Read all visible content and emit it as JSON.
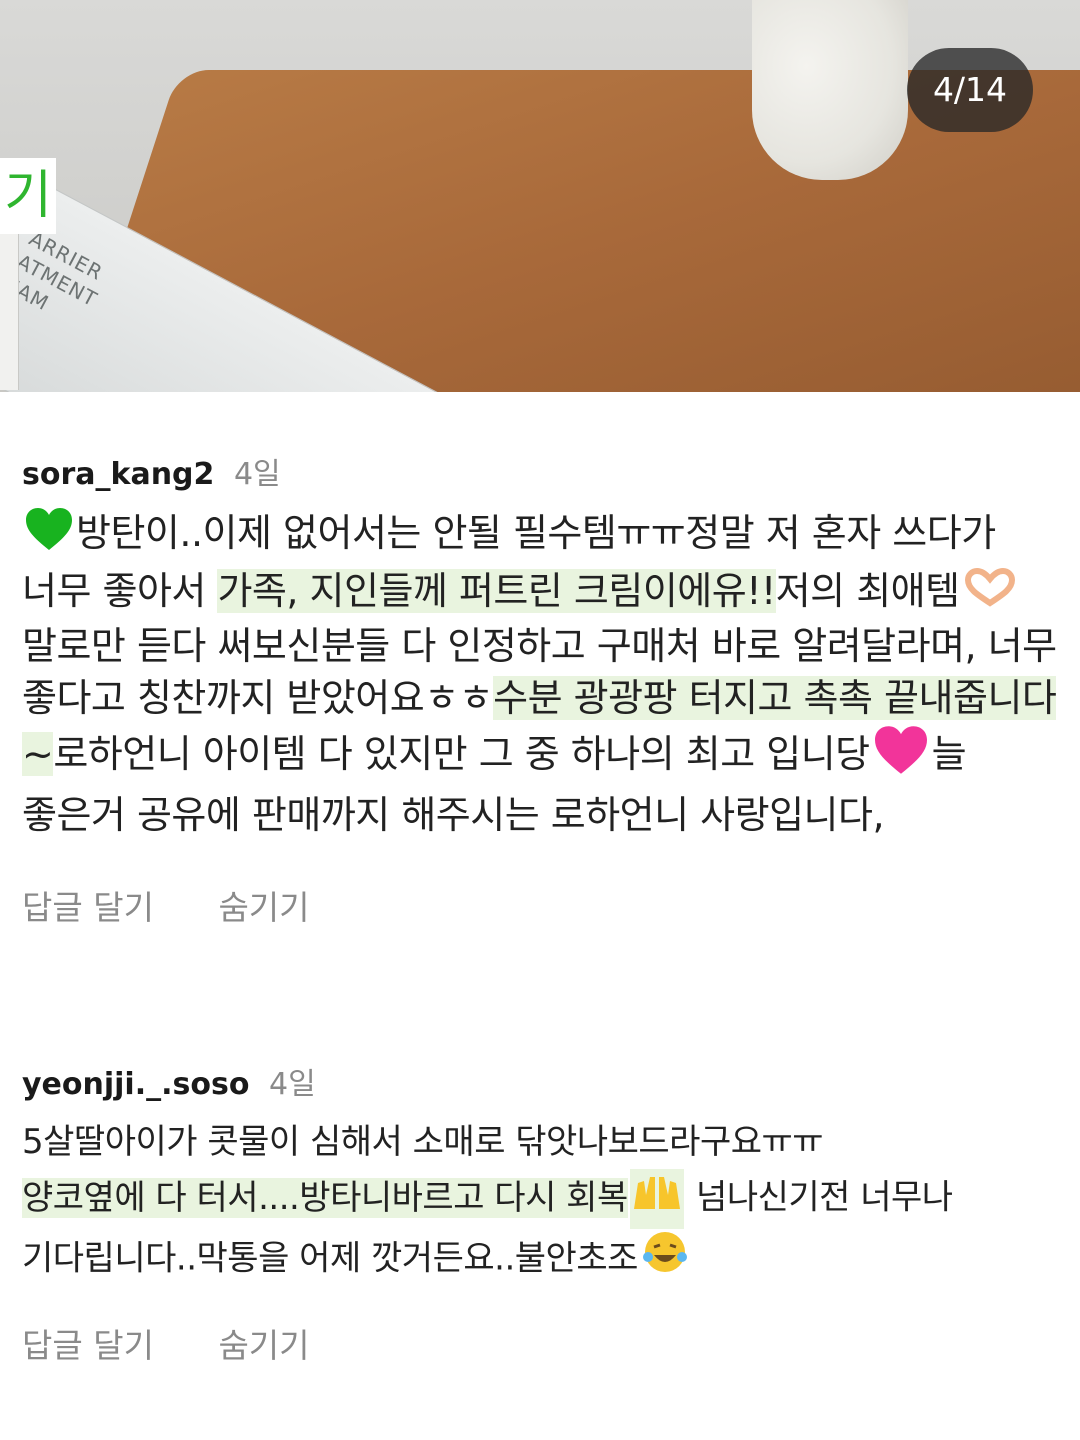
{
  "photo": {
    "counter": "4/14",
    "side_label": "기",
    "box_text": "ARRIER\nATMENT\nEAM"
  },
  "comments": [
    {
      "username": "sora_kang2",
      "time": "4일",
      "text": {
        "p1": "방탄이..이제 없어서는 안될 필수템ㅠㅠ정말 저 혼자 쓰다가 너무 좋아서 ",
        "h1": "가족, 지인들께 퍼트린 크림이에유!!",
        "p2": "저의 최애템",
        "p3": "말로만 듣다 써보신분들 다 인정하고 구매처 바로 알려달라며, 너무 좋다고 칭찬까지 받았어요ㅎㅎ",
        "h2": "수분 광광팡 터지고 촉촉 끝내줍니다~",
        "p4": "로하언니 아이템 다 있지만 그 중 하나의 최고 입니당",
        "p5": "늘 좋은거 공유에 판매까지 해주시는 로하언니 사랑입니다,"
      },
      "emojis": [
        "green-heart-icon",
        "heart-hands-icon",
        "pink-heart-icon"
      ],
      "actions": {
        "reply": "답글 달기",
        "hide": "숨기기"
      }
    },
    {
      "username": "yeonjji._.soso",
      "time": "4일",
      "text": {
        "p1": "5살딸아이가 콧물이 심해서 소매로 닦앗나보드라구요ㅠㅠ",
        "h1": "양코옆에 다 터서....방타니바르고 다시 회복",
        "p2": " 넘나신기전 너무나 기다립니다..막통을 어제 깟거든요..불안초조"
      },
      "emojis": [
        "raising-hands-icon",
        "tears-of-joy-icon"
      ],
      "actions": {
        "reply": "답글 달기",
        "hide": "숨기기"
      }
    }
  ]
}
